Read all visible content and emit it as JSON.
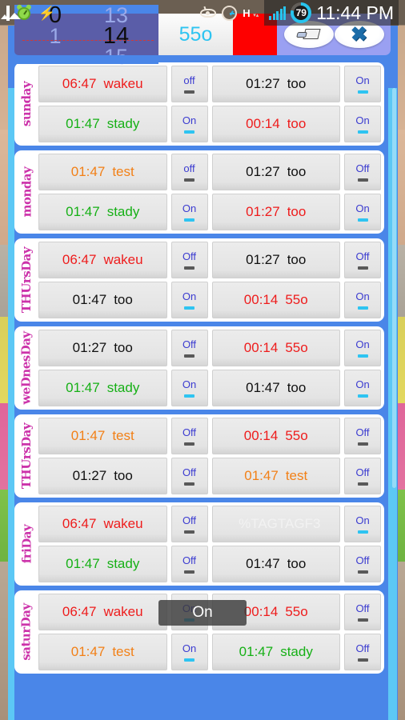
{
  "statusbar": {
    "icons_left": [
      "gallery-icon",
      "alarm-clock-icon",
      "lightning-bolt-icon"
    ],
    "icons_right": [
      "eye-icon",
      "clock-icon",
      "h-network-icon",
      "signal-bars-icon",
      "battery-icon"
    ],
    "network_type": "H",
    "network_arrows": "▾▴",
    "battery_percent": "79",
    "time": "11:44 PM"
  },
  "topbar": {
    "picker": {
      "col1": {
        "above": "",
        "value": "0",
        "below": "1"
      },
      "col2": {
        "above": "13",
        "value": "14",
        "below": "15"
      }
    },
    "value_display": "55o",
    "color_swatch": "#fe0000",
    "eraser_button_icon": "eraser-icon",
    "close_button_icon": "close-x-icon"
  },
  "days": [
    {
      "name": "sunday",
      "alarms": [
        {
          "time": "06:47",
          "label": "wakeu",
          "color": "c-red",
          "toggle": "off",
          "state": "off"
        },
        {
          "time": "01:27",
          "label": "too",
          "color": "c-black",
          "toggle": "On",
          "state": "on"
        },
        {
          "time": "01:47",
          "label": "stady",
          "color": "c-green",
          "toggle": "On",
          "state": "on"
        },
        {
          "time": "00:14",
          "label": "too",
          "color": "c-red",
          "toggle": "On",
          "state": "on"
        }
      ]
    },
    {
      "name": "monday",
      "alarms": [
        {
          "time": "01:47",
          "label": "test",
          "color": "c-orange",
          "toggle": "off",
          "state": "off"
        },
        {
          "time": "01:27",
          "label": "too",
          "color": "c-black",
          "toggle": "Off",
          "state": "off"
        },
        {
          "time": "01:47",
          "label": "stady",
          "color": "c-green",
          "toggle": "On",
          "state": "on"
        },
        {
          "time": "01:27",
          "label": "too",
          "color": "c-red",
          "toggle": "On",
          "state": "on"
        }
      ]
    },
    {
      "name": "THUrsDay",
      "alarms": [
        {
          "time": "06:47",
          "label": "wakeu",
          "color": "c-red",
          "toggle": "Off",
          "state": "off"
        },
        {
          "time": "01:27",
          "label": "too",
          "color": "c-black",
          "toggle": "Off",
          "state": "off"
        },
        {
          "time": "01:47",
          "label": "too",
          "color": "c-black",
          "toggle": "On",
          "state": "on"
        },
        {
          "time": "00:14",
          "label": "55o",
          "color": "c-red",
          "toggle": "On",
          "state": "on"
        }
      ]
    },
    {
      "name": "weDnesDay",
      "alarms": [
        {
          "time": "01:27",
          "label": "too",
          "color": "c-black",
          "toggle": "Off",
          "state": "off"
        },
        {
          "time": "00:14",
          "label": "55o",
          "color": "c-red",
          "toggle": "On",
          "state": "on"
        },
        {
          "time": "01:47",
          "label": "stady",
          "color": "c-green",
          "toggle": "On",
          "state": "on"
        },
        {
          "time": "01:47",
          "label": "too",
          "color": "c-black",
          "toggle": "On",
          "state": "on"
        }
      ]
    },
    {
      "name": "THUrsDay",
      "alarms": [
        {
          "time": "01:47",
          "label": "test",
          "color": "c-orange",
          "toggle": "Off",
          "state": "off"
        },
        {
          "time": "00:14",
          "label": "55o",
          "color": "c-red",
          "toggle": "Off",
          "state": "off"
        },
        {
          "time": "01:27",
          "label": "too",
          "color": "c-black",
          "toggle": "Off",
          "state": "off"
        },
        {
          "time": "01:47",
          "label": "test",
          "color": "c-orange",
          "toggle": "Off",
          "state": "off"
        }
      ]
    },
    {
      "name": "friDay",
      "alarms": [
        {
          "time": "06:47",
          "label": "wakeu",
          "color": "c-red",
          "toggle": "Off",
          "state": "off"
        },
        {
          "time": "",
          "label": "%TAGTAGF3",
          "color": "c-faded",
          "toggle": "On",
          "state": "on"
        },
        {
          "time": "01:47",
          "label": "stady",
          "color": "c-green",
          "toggle": "Off",
          "state": "off"
        },
        {
          "time": "01:47",
          "label": "too",
          "color": "c-black",
          "toggle": "Off",
          "state": "off"
        }
      ]
    },
    {
      "name": "saturDay",
      "alarms": [
        {
          "time": "06:47",
          "label": "wakeu",
          "color": "c-red",
          "toggle": "On",
          "state": "on"
        },
        {
          "time": "00:14",
          "label": "55o",
          "color": "c-red",
          "toggle": "Off",
          "state": "off"
        },
        {
          "time": "01:47",
          "label": "test",
          "color": "c-orange",
          "toggle": "On",
          "state": "on"
        },
        {
          "time": "01:47",
          "label": "stady",
          "color": "c-green",
          "toggle": "Off",
          "state": "off"
        }
      ]
    }
  ],
  "toast": {
    "message": "On"
  }
}
